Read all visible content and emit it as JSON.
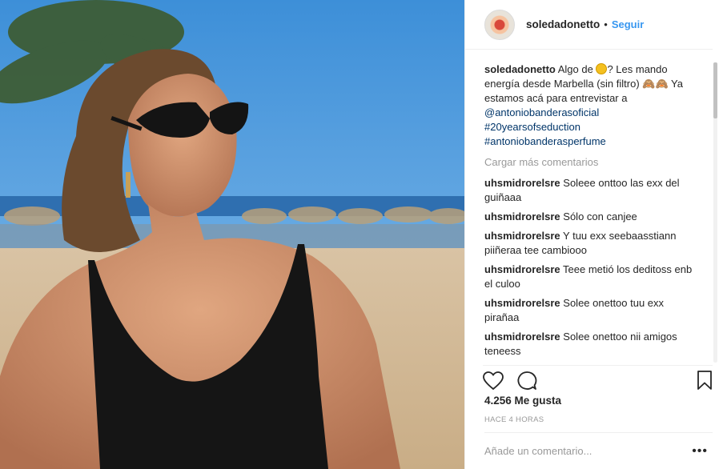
{
  "post": {
    "username": "soledadonetto",
    "dot": "•",
    "follow_label": "Seguir",
    "caption": {
      "user": "soledadonetto",
      "part1": "Algo de ",
      "part2": "? Les mando energía desde Marbella (sin filtro) ",
      "part3": " Ya estamos acá para entrevistar a",
      "mention": "@antoniobanderasoficial",
      "hashtag1": "#20yearsofseduction",
      "hashtag2": "#antoniobanderasperfume"
    },
    "load_more": "Cargar más comentarios",
    "comments": [
      {
        "user": "uhsmidrorelsre",
        "text": "Soleee onttoo las exx del guiñaaa"
      },
      {
        "user": "uhsmidrorelsre",
        "text": "Sólo con canjee"
      },
      {
        "user": "uhsmidrorelsre",
        "text": "Y tuu exx seebaasstiann piiñeraa tee cambiooo"
      },
      {
        "user": "uhsmidrorelsre",
        "text": "Teee metió los deditoss enb el culoo"
      },
      {
        "user": "uhsmidrorelsre",
        "text": "Solee onettoo tuu exx pirañaa"
      },
      {
        "user": "uhsmidrorelsre",
        "text": "Solee onettoo nii amigos teneess"
      }
    ],
    "likes": "4.256 Me gusta",
    "time": "HACE 4 HORAS",
    "add_comment_placeholder": "Añade un comentario...",
    "more_label": "•••"
  },
  "icons": {
    "avatar": "avatar",
    "heart": "heart-icon",
    "comment": "comment-bubble-icon",
    "bookmark": "bookmark-icon",
    "sun_emoji": "sun-emoji",
    "monkey_emoji": "see-no-evil-monkey-emoji"
  },
  "colors": {
    "link": "#003569",
    "follow": "#3897f0",
    "muted": "#999999"
  }
}
